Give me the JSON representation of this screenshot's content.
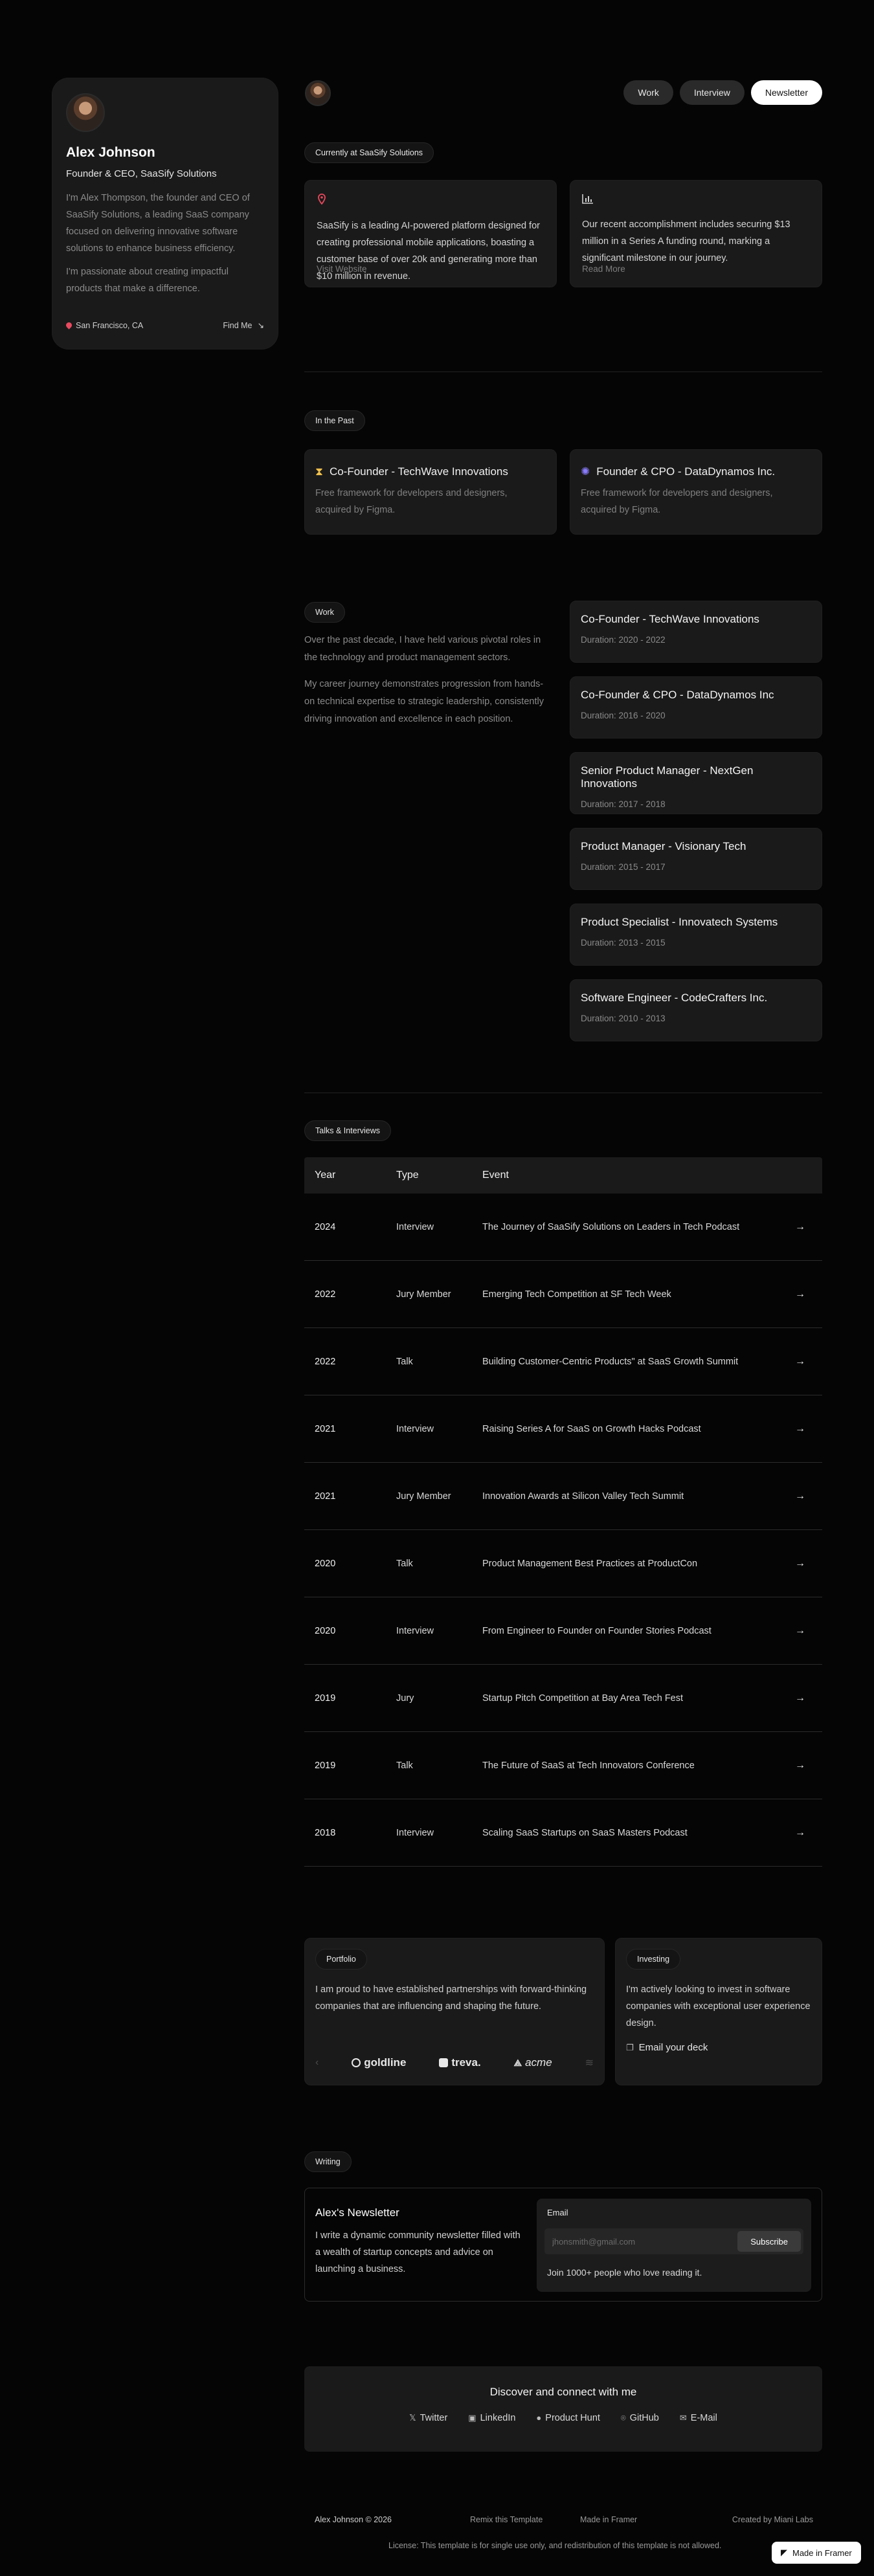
{
  "profile": {
    "name": "Alex Johnson",
    "role": "Founder & CEO, SaaSify Solutions",
    "bio1": "I'm Alex Thompson, the founder and CEO of SaaSify Solutions, a leading SaaS company focused on delivering innovative software solutions to enhance business efficiency.",
    "bio2": "I'm passionate about creating impactful products that make a difference.",
    "location": "San Francisco, CA",
    "find_me": "Find Me",
    "find_me_icon": "arrow-down-right-icon"
  },
  "nav": {
    "work": "Work",
    "interview": "Interview",
    "newsletter": "Newsletter"
  },
  "current": {
    "tag": "Currently at SaaSify Solutions",
    "card1": {
      "icon": "map-pin-icon",
      "text": "SaaSify is a leading AI-powered platform designed for creating professional mobile applications, boasting a customer base of over 20k and generating more than $10 million in revenue.",
      "link": "Visit Website"
    },
    "card2": {
      "icon": "bar-chart-icon",
      "text": "Our recent accomplishment includes securing $13 million in a Series A funding round, marking a significant milestone in our journey.",
      "link": "Read More"
    }
  },
  "past": {
    "tag": "In the Past",
    "items": [
      {
        "title": "Co-Founder - TechWave Innovations",
        "desc": "Free framework for developers and designers, acquired by Figma.",
        "icon": "hourglass-icon",
        "color": "#f2c14e"
      },
      {
        "title": "Founder & CPO - DataDynamos Inc.",
        "desc": "Free framework for developers and designers, acquired by Figma.",
        "icon": "spinner-icon",
        "color": "#8a7cff"
      }
    ]
  },
  "work": {
    "tag": "Work",
    "p1": "Over the past decade, I have held various pivotal roles in the technology and product management sectors.",
    "p2": "My career journey demonstrates progression from hands-on technical expertise to strategic leadership, consistently driving innovation and excellence in each position.",
    "jobs": [
      {
        "title": "Co-Founder - TechWave Innovations",
        "duration": "Duration: 2020 - 2022"
      },
      {
        "title": "Co-Founder & CPO - DataDynamos Inc",
        "duration": "Duration: 2016 - 2020"
      },
      {
        "title": "Senior Product Manager - NextGen Innovations",
        "duration": "Duration: 2017 - 2018"
      },
      {
        "title": "Product Manager - Visionary Tech",
        "duration": "Duration: 2015 - 2017"
      },
      {
        "title": "Product Specialist - Innovatech Systems",
        "duration": "Duration: 2013 - 2015"
      },
      {
        "title": "Software Engineer - CodeCrafters Inc.",
        "duration": "Duration: 2010 - 2013"
      }
    ]
  },
  "talks": {
    "tag": "Talks & Interviews",
    "headers": [
      "Year",
      "Type",
      "Event"
    ],
    "rows": [
      {
        "year": "2024",
        "type": "Interview",
        "event": "The Journey of SaaSify Solutions on Leaders in Tech Podcast"
      },
      {
        "year": "2022",
        "type": "Jury Member",
        "event": "Emerging Tech Competition at SF Tech Week"
      },
      {
        "year": "2022",
        "type": "Talk",
        "event": "Building Customer-Centric Products\" at SaaS Growth Summit"
      },
      {
        "year": "2021",
        "type": "Interview",
        "event": "Raising Series A for SaaS on Growth Hacks Podcast"
      },
      {
        "year": "2021",
        "type": "Jury Member",
        "event": "Innovation Awards at Silicon Valley Tech Summit"
      },
      {
        "year": "2020",
        "type": "Talk",
        "event": "Product Management Best Practices at ProductCon"
      },
      {
        "year": "2020",
        "type": "Interview",
        "event": "From Engineer to Founder on Founder Stories Podcast"
      },
      {
        "year": "2019",
        "type": "Jury",
        "event": "Startup Pitch Competition at Bay Area Tech Fest"
      },
      {
        "year": "2019",
        "type": "Talk",
        "event": "The Future of SaaS at Tech Innovators Conference"
      },
      {
        "year": "2018",
        "type": "Interview",
        "event": "Scaling SaaS Startups on SaaS Masters Podcast"
      }
    ]
  },
  "portfolio": {
    "tag": "Portfolio",
    "text": "I am proud to have established partnerships with forward-thinking companies that are influencing and shaping the future.",
    "logos": [
      "goldline",
      "treva.",
      "acme"
    ]
  },
  "investing": {
    "tag": "Investing",
    "text": "I'm actively looking to invest in software companies with exceptional user experience design.",
    "email_label": "Email your deck"
  },
  "writing": {
    "tag": "Writing",
    "title": "Alex's Newsletter",
    "desc": "I write a dynamic community newsletter filled with a wealth of startup concepts and advice on launching a business.",
    "email_label": "Email",
    "placeholder": "jhonsmith@gmail.com",
    "subscribe": "Subscribe",
    "count": "Join 1000+ people who love reading it."
  },
  "connect": {
    "title": "Discover and connect with me",
    "links": [
      {
        "label": "Twitter",
        "icon": "x-icon"
      },
      {
        "label": "LinkedIn",
        "icon": "linkedin-icon"
      },
      {
        "label": "Product Hunt",
        "icon": "product-hunt-icon"
      },
      {
        "label": "GitHub",
        "icon": "github-icon"
      },
      {
        "label": "E-Mail",
        "icon": "mail-icon"
      }
    ]
  },
  "footer": {
    "copyright": "Alex Johnson © 2026",
    "remix": "Remix this Template",
    "made": "Made in Framer",
    "created": "Created by Miani Labs",
    "license": "License: This template is for single use only, and redistribution of this template is not allowed.",
    "badge": "Made in Framer"
  }
}
